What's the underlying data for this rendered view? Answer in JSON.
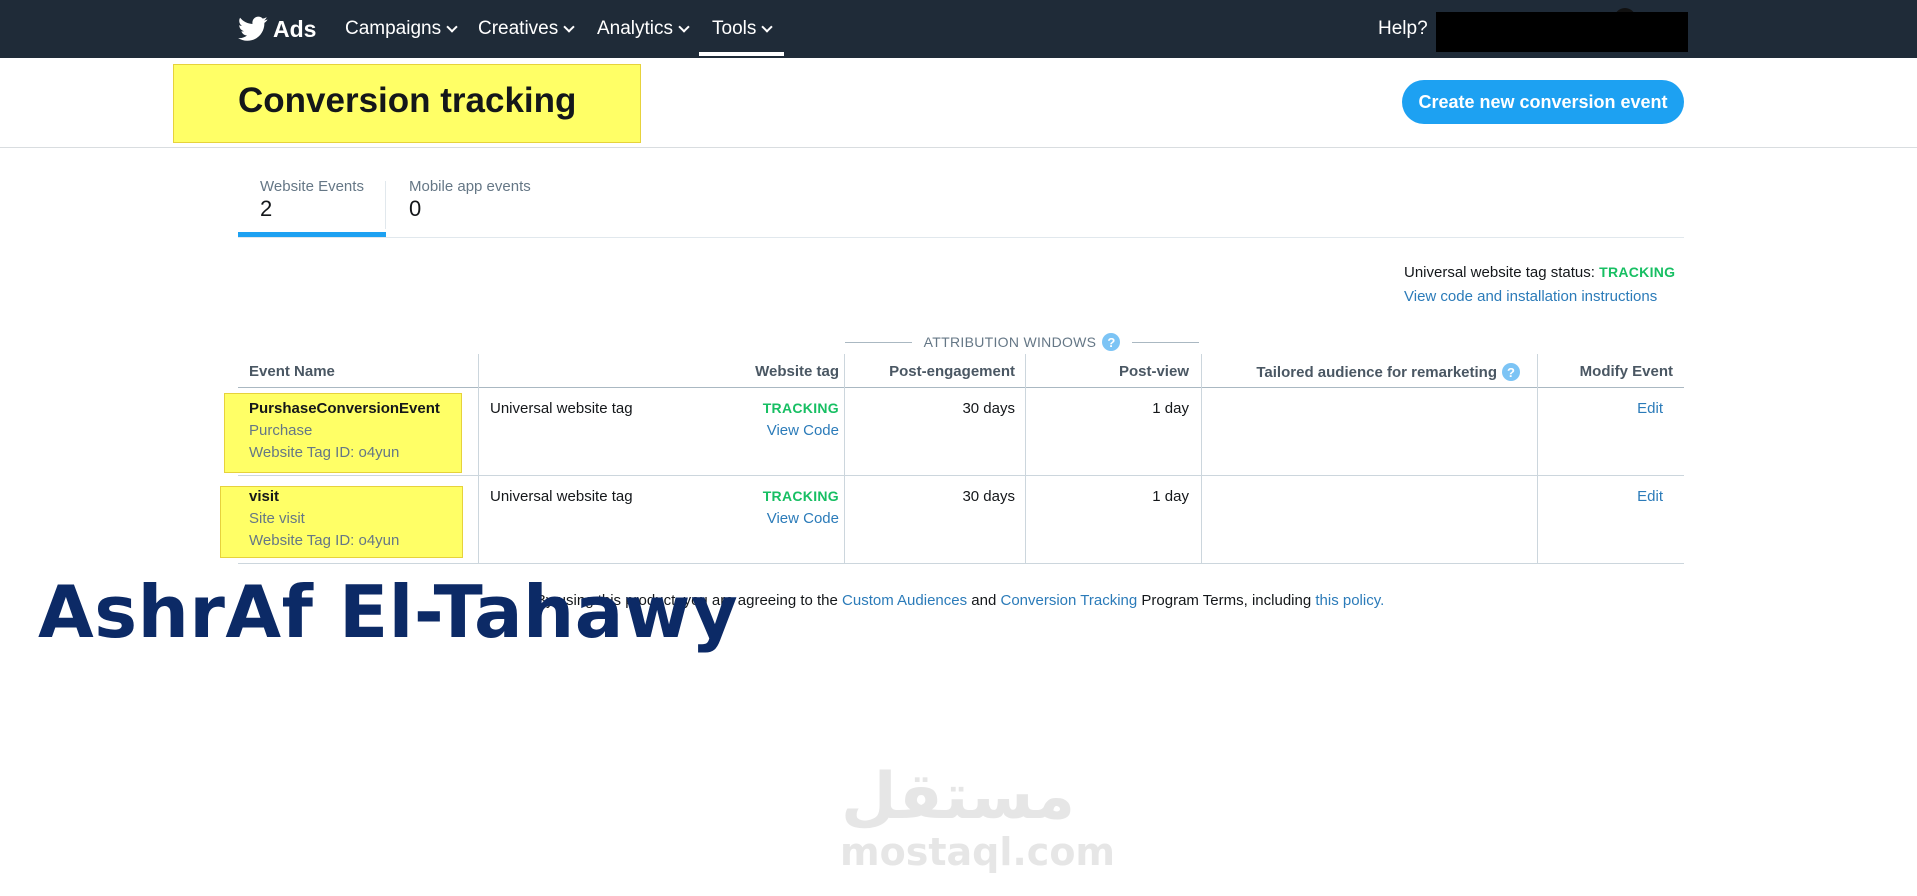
{
  "nav": {
    "brand": "Ads",
    "items": [
      {
        "label": "Campaigns"
      },
      {
        "label": "Creatives"
      },
      {
        "label": "Analytics"
      },
      {
        "label": "Tools"
      }
    ],
    "active_item": "Tools",
    "help": "Help?"
  },
  "header": {
    "title": "Conversion tracking",
    "create_button": "Create new conversion event"
  },
  "tabs": [
    {
      "label": "Website Events",
      "count": "2"
    },
    {
      "label": "Mobile app events",
      "count": "0"
    }
  ],
  "status": {
    "label": "Universal website tag status:",
    "value": "TRACKING",
    "code_link": "View code and installation instructions"
  },
  "attribution": {
    "label": "ATTRIBUTION WINDOWS",
    "help_icon": "?"
  },
  "table": {
    "headers": {
      "event_name": "Event Name",
      "website_tag": "Website tag",
      "post_engagement": "Post-engagement",
      "post_view": "Post-view",
      "tailored": "Tailored audience for remarketing",
      "tailored_help": "?",
      "modify": "Modify Event"
    },
    "rows": [
      {
        "name": "PurshaseConversionEvent",
        "type": "Purchase",
        "tag_id": "Website Tag ID: o4yun",
        "tag": "Universal website tag",
        "tag_status": "TRACKING",
        "view_code": "View Code",
        "post_engagement": "30 days",
        "post_view": "1 day",
        "edit": "Edit"
      },
      {
        "name": "visit",
        "type": "Site visit",
        "tag_id": "Website Tag ID: o4yun",
        "tag": "Universal website tag",
        "tag_status": "TRACKING",
        "view_code": "View Code",
        "post_engagement": "30 days",
        "post_view": "1 day",
        "edit": "Edit"
      }
    ]
  },
  "terms": {
    "prefix": "By using this product, you are agreeing to the",
    "link1": "Custom Audiences",
    "and": "and",
    "link2": "Conversion Tracking",
    "middle": "Program Terms, including",
    "link3": "this policy."
  },
  "overlay_text": "AshrAf El-Tahawy",
  "watermark": {
    "arabic": "مستقل",
    "latin": "mostaql.com"
  },
  "colors": {
    "nav_bg": "#1f2b38",
    "accent": "#1da1f2",
    "tracking_green": "#17bf63",
    "link_blue": "#2b7bb9",
    "highlight": "#ffff66",
    "overlay_text": "#0c2a66"
  }
}
